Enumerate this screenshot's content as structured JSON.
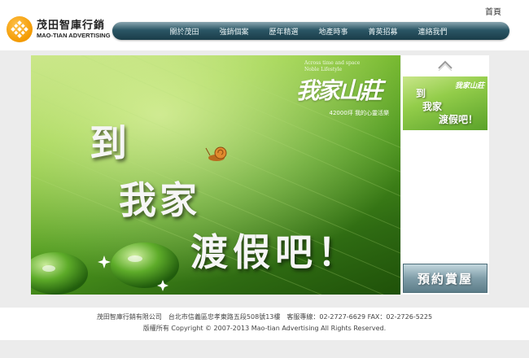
{
  "header": {
    "logo_cn": "茂田智庫行銷",
    "logo_en": "MAO-TIAN ADVERTISING",
    "home_link": "首頁",
    "nav": [
      "關於茂田",
      "強銷個案",
      "歷年精選",
      "地產時事",
      "菁英招募",
      "連絡我們"
    ]
  },
  "banner": {
    "tagline": "Across time and space\nNoble Lifestyle",
    "brand_name": "我家山莊",
    "brand_sub": "42000坪 我的心靈活樂",
    "slogan": [
      "到",
      "我家",
      "渡假吧！"
    ]
  },
  "side": {
    "thumb_brand": "我家山莊",
    "thumb_lines": [
      "到",
      "我家",
      "渡假吧！"
    ],
    "reserve_button": "預約賞屋"
  },
  "footer": {
    "line1": "茂田智庫行銷有限公司　台北市信義區忠孝東路五段508號13樓　客服專線：02-2727-6629 FAX：02-2726-5225",
    "line2": "版權所有 Copyright © 2007-2013 Mao-tian Advertising All Rights Reserved."
  },
  "colors": {
    "nav_dark": "#1a3d49",
    "logo_orange": "#f39a00",
    "banner_green": "#4f9a1e",
    "button_slate": "#7f9da8"
  }
}
